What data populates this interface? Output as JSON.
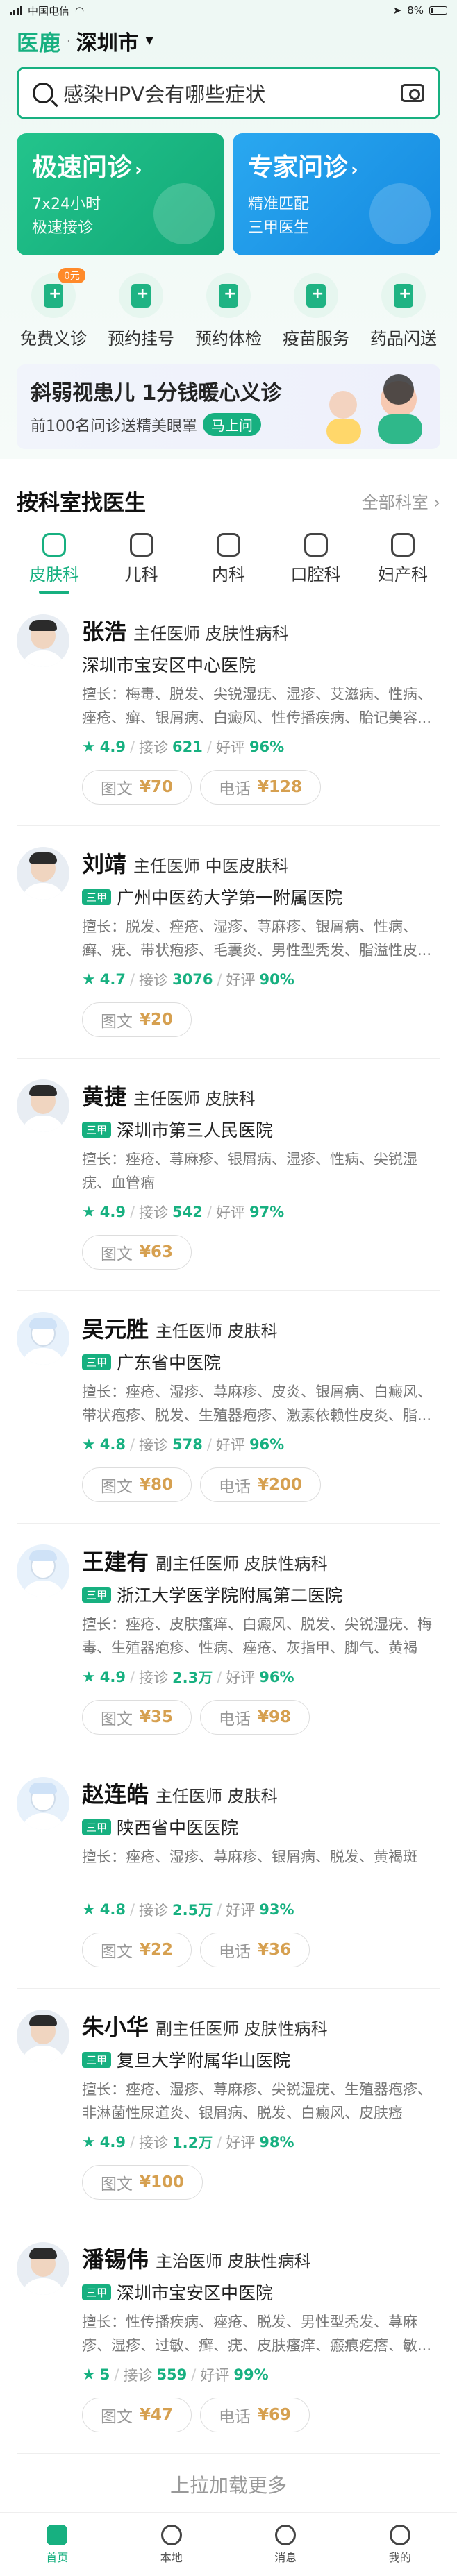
{
  "status": {
    "carrier": "中国电信",
    "battery": "8%"
  },
  "header": {
    "logo": "医鹿",
    "city": "深圳市"
  },
  "search": {
    "placeholder": "感染HPV会有哪些症状"
  },
  "consult": [
    {
      "title": "极速问诊",
      "lines": [
        "7x24小时",
        "极速接诊"
      ]
    },
    {
      "title": "专家问诊",
      "lines": [
        "精准匹配",
        "三甲医生"
      ]
    }
  ],
  "quick": [
    {
      "label": "免费义诊",
      "badge": "0元",
      "icon": "heart-doc-icon"
    },
    {
      "label": "预约挂号",
      "icon": "register-icon"
    },
    {
      "label": "预约体检",
      "icon": "checkup-icon"
    },
    {
      "label": "疫苗服务",
      "icon": "vaccine-icon"
    },
    {
      "label": "药品闪送",
      "icon": "pill-icon"
    }
  ],
  "banner": {
    "title": "斜弱视患儿 1分钱暖心义诊",
    "sub": "前100名问诊送精美眼罩",
    "btn": "马上问"
  },
  "section": {
    "title": "按科室找医生",
    "all": "全部科室"
  },
  "depts": [
    {
      "label": "皮肤科",
      "icon": "skin-icon"
    },
    {
      "label": "儿科",
      "icon": "child-icon"
    },
    {
      "label": "内科",
      "icon": "internal-icon"
    },
    {
      "label": "口腔科",
      "icon": "tooth-icon"
    },
    {
      "label": "妇产科",
      "icon": "gyn-icon"
    }
  ],
  "doctors": [
    {
      "name": "张浩",
      "title": "主任医师 皮肤性病科",
      "grade": "",
      "hospital": "深圳市宝安区中心医院",
      "skill": "擅长：梅毒、脱发、尖锐湿疣、湿疹、艾滋病、性病、痤疮、癣、银屑病、白癜风、性传播疾病、胎记美容...",
      "rating": "4.9",
      "visits": "621",
      "rate": "96%",
      "prices": [
        {
          "label": "图文",
          "value": "¥70"
        },
        {
          "label": "电话",
          "value": "¥128"
        }
      ]
    },
    {
      "name": "刘靖",
      "title": "主任医师 中医皮肤科",
      "grade": "三甲",
      "hospital": "广州中医药大学第一附属医院",
      "skill": "擅长：脱发、痤疮、湿疹、荨麻疹、银屑病、性病、癣、疣、带状疱疹、毛囊炎、男性型秃发、脂溢性皮...",
      "rating": "4.7",
      "visits": "3076",
      "rate": "90%",
      "prices": [
        {
          "label": "图文",
          "value": "¥20"
        }
      ]
    },
    {
      "name": "黄捷",
      "title": "主任医师 皮肤科",
      "grade": "三甲",
      "hospital": "深圳市第三人民医院",
      "skill": "擅长：痤疮、荨麻疹、银屑病、湿疹、性病、尖锐湿疣、血管瘤",
      "rating": "4.9",
      "visits": "542",
      "rate": "97%",
      "prices": [
        {
          "label": "图文",
          "value": "¥63"
        }
      ]
    },
    {
      "name": "吴元胜",
      "title": "主任医师 皮肤科",
      "grade": "三甲",
      "hospital": "广东省中医院",
      "skill": "擅长：痤疮、湿疹、荨麻疹、皮炎、银屑病、白癜风、带状疱疹、脱发、生殖器疱疹、激素依赖性皮炎、脂...",
      "rating": "4.8",
      "visits": "578",
      "rate": "96%",
      "prices": [
        {
          "label": "图文",
          "value": "¥80"
        },
        {
          "label": "电话",
          "value": "¥200"
        }
      ]
    },
    {
      "name": "王建有",
      "title": "副主任医师 皮肤性病科",
      "grade": "三甲",
      "hospital": "浙江大学医学院附属第二医院",
      "skill": "擅长：痤疮、皮肤瘙痒、白癜风、脱发、尖锐湿疣、梅毒、生殖器疱疹、性病、痤疮、灰指甲、脚气、黄褐斑、痣...",
      "rating": "4.9",
      "visits": "2.3万",
      "rate": "96%",
      "prices": [
        {
          "label": "图文",
          "value": "¥35"
        },
        {
          "label": "电话",
          "value": "¥98"
        }
      ]
    },
    {
      "name": "赵连皓",
      "title": "主任医师 皮肤科",
      "grade": "三甲",
      "hospital": "陕西省中医医院",
      "skill": "擅长：痤疮、湿疹、荨麻疹、银屑病、脱发、黄褐斑",
      "rating": "4.8",
      "visits": "2.5万",
      "rate": "93%",
      "prices": [
        {
          "label": "图文",
          "value": "¥22"
        },
        {
          "label": "电话",
          "value": "¥36"
        }
      ]
    },
    {
      "name": "朱小华",
      "title": "副主任医师 皮肤性病科",
      "grade": "三甲",
      "hospital": "复旦大学附属华山医院",
      "skill": "擅长：痤疮、湿疹、荨麻疹、尖锐湿疣、生殖器疱疹、非淋菌性尿道炎、银屑病、脱发、白癜风、皮肤瘙痒、...",
      "rating": "4.9",
      "visits": "1.2万",
      "rate": "98%",
      "prices": [
        {
          "label": "图文",
          "value": "¥100"
        }
      ]
    },
    {
      "name": "潘锡伟",
      "title": "主治医师 皮肤性病科",
      "grade": "三甲",
      "hospital": "深圳市宝安区中医院",
      "skill": "擅长：性传播疾病、痤疮、脱发、男性型秃发、荨麻疹、湿疹、过敏、癣、疣、皮肤瘙痒、瘢痕疙瘩、敏...",
      "rating": "5",
      "visits": "559",
      "rate": "99%",
      "prices": [
        {
          "label": "图文",
          "value": "¥47"
        },
        {
          "label": "电话",
          "value": "¥69"
        }
      ]
    }
  ],
  "stats_labels": {
    "visits": "接诊",
    "rate": "好评"
  },
  "loadmore": "上拉加载更多",
  "nav": [
    {
      "label": "首页",
      "icon": "home-icon"
    },
    {
      "label": "本地",
      "icon": "location-icon"
    },
    {
      "label": "消息",
      "icon": "message-icon"
    },
    {
      "label": "我的",
      "icon": "user-icon"
    }
  ]
}
